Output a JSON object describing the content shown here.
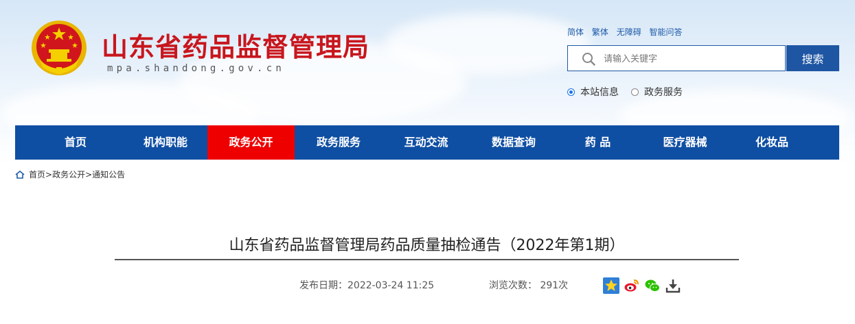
{
  "header": {
    "site_title": "山东省药品监督管理局",
    "site_domain": "mpa.shandong.gov.cn",
    "lang_links": [
      "简体",
      "繁体",
      "无障碍",
      "智能问答"
    ],
    "search": {
      "placeholder": "请输入关键字",
      "button_label": "搜索"
    },
    "scope_options": [
      {
        "label": "本站信息",
        "checked": true
      },
      {
        "label": "政务服务",
        "checked": false
      }
    ]
  },
  "nav": {
    "items": [
      "首页",
      "机构职能",
      "政务公开",
      "政务服务",
      "互动交流",
      "数据查询",
      "药 品",
      "医疗器械",
      "化妆品"
    ],
    "active_index": 2
  },
  "breadcrumb": [
    "首页",
    ">",
    "政务公开",
    ">",
    "通知公告"
  ],
  "article": {
    "title": "山东省药品监督管理局药品质量抽检通告（2022年第1期）",
    "publish_date": "发布日期：2022-03-24 11:25",
    "views": "浏览次数： 291次"
  },
  "colors": {
    "brand_red": "#c8161d",
    "nav_blue": "#0f4fa3",
    "nav_active": "#ee0000",
    "search_blue": "#1f56a3"
  },
  "share_icons": [
    "favorite-star-icon",
    "weibo-icon",
    "wechat-icon",
    "download-icon"
  ]
}
